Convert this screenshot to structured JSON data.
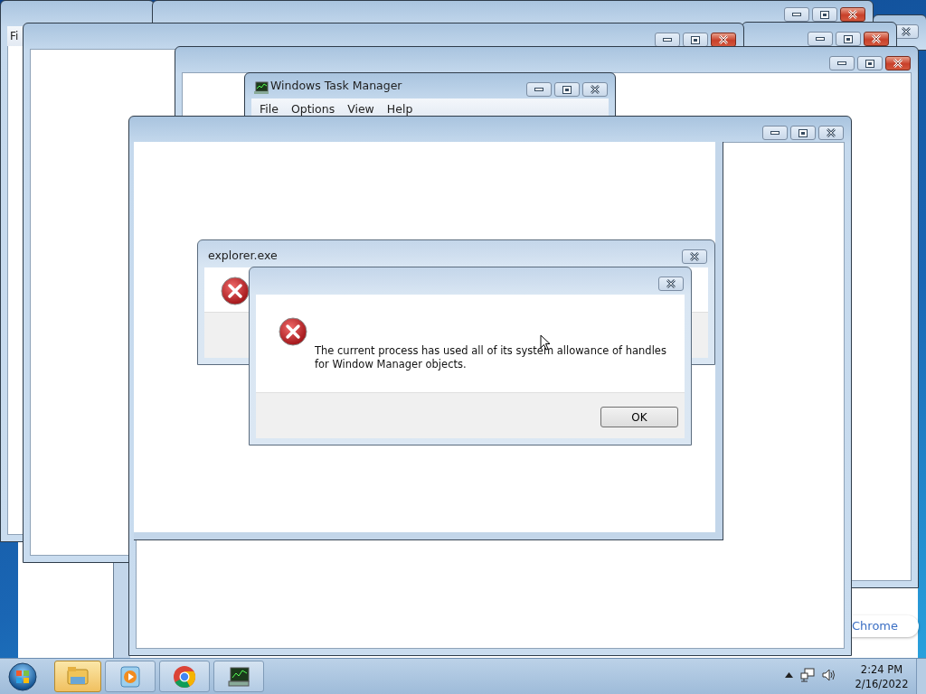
{
  "windows": [
    {
      "kind": "partial",
      "menu": [
        "Fi"
      ]
    },
    {
      "kind": "stub",
      "active": false
    },
    {
      "kind": "blank",
      "active": true
    },
    {
      "kind": "blank",
      "active": true
    },
    {
      "kind": "blank",
      "active": true
    },
    {
      "kind": "blank",
      "active": true
    },
    {
      "kind": "app",
      "title": "Windows Task Manager",
      "menu": [
        "File",
        "Options",
        "View",
        "Help"
      ],
      "active": false
    },
    {
      "kind": "blank",
      "active": false
    },
    {
      "kind": "dialog",
      "title": "explorer.exe"
    },
    {
      "kind": "message",
      "message": "The current process has used all of its system allowance of handles for Window Manager objects.",
      "button": "OK"
    }
  ],
  "notification": {
    "text": "Chrome"
  },
  "taskbar": {
    "buttons": [
      {
        "kind": "explorer",
        "selected": true
      },
      {
        "kind": "media",
        "selected": false
      },
      {
        "kind": "chrome",
        "selected": false
      },
      {
        "kind": "taskmgr",
        "selected": false
      }
    ],
    "time": "2:24 PM",
    "date": "2/16/2022"
  }
}
